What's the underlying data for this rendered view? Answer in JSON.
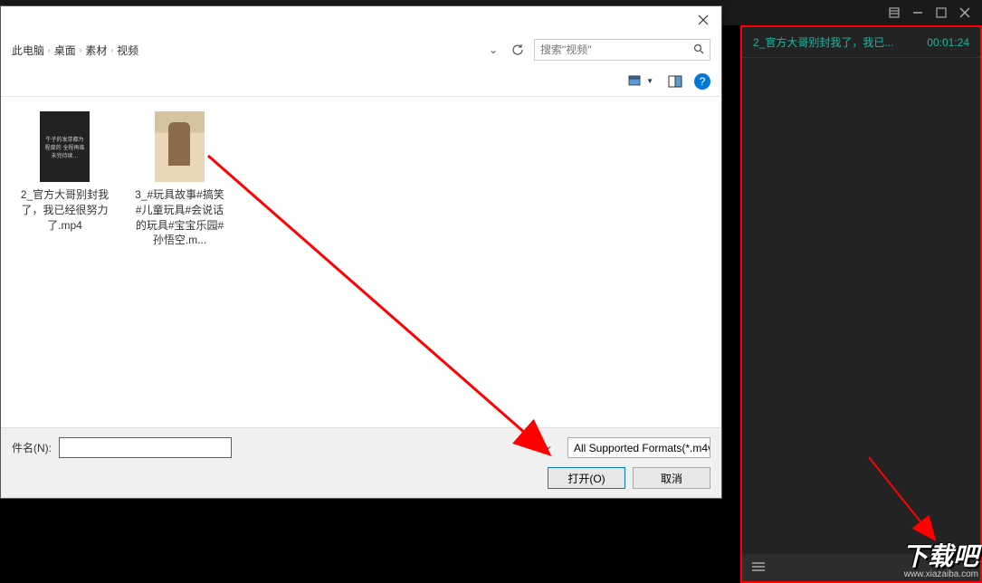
{
  "app": {
    "title_fragment": "2_官方大哥别封我了，我已经很努力了.mp4"
  },
  "dialog": {
    "breadcrumb": {
      "items": [
        "此电脑",
        "桌面",
        "素材",
        "视频"
      ]
    },
    "search": {
      "placeholder": "搜索\"视频\""
    },
    "files": [
      {
        "name": "2_官方大哥别封我了，我已经很努力了.mp4",
        "thumb_text": "牛子的发芽都为程度的\n全程再临\n\n未完待续…"
      },
      {
        "name": "3_#玩具故事#搞笑#儿童玩具#会说话的玩具#宝宝乐园#孙悟空.m..."
      }
    ],
    "filename_label": "件名(N):",
    "format_label": "All Supported Formats(*.m4v",
    "open_button": "打开(O)",
    "cancel_button": "取消",
    "help_char": "?"
  },
  "playlist": {
    "title": "2_官方大哥别封我了，我已...",
    "time": "00:01:24"
  },
  "watermark": {
    "main": "下载吧",
    "url": "www.xiazaiba.com"
  },
  "colors": {
    "accent": "#1db5a5",
    "arrow": "#ff0000"
  }
}
